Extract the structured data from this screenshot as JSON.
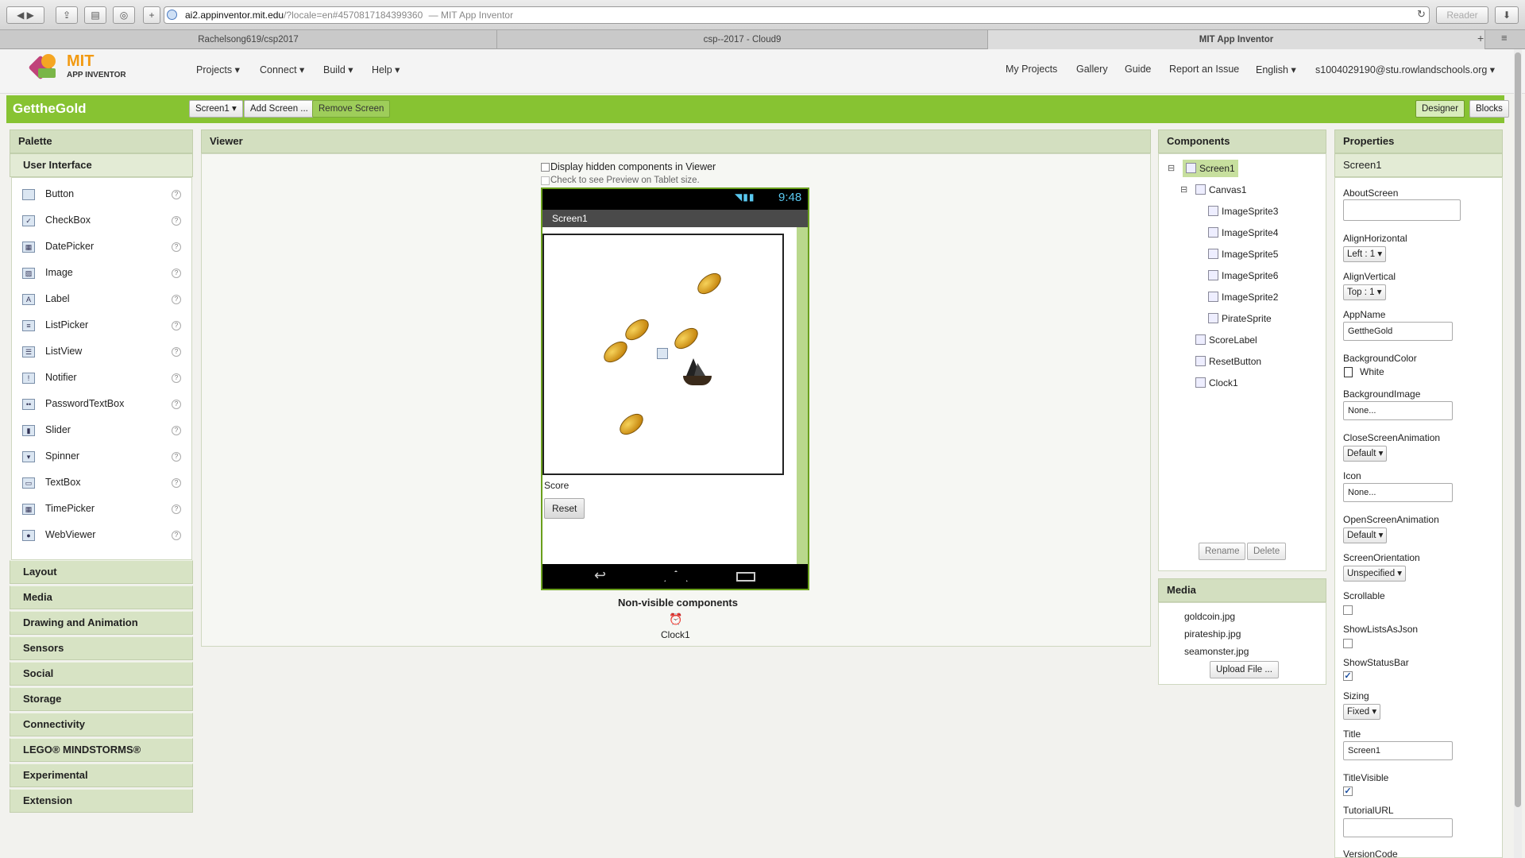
{
  "browser": {
    "url_host": "ai2.appinventor.mit.edu",
    "url_path": "/?locale=en#4570817184399360",
    "page_title": "— MIT App Inventor",
    "reader_label": "Reader",
    "tabs": [
      "Rachelsong619/csp2017",
      "csp--2017 - Cloud9",
      "MIT App Inventor"
    ]
  },
  "header": {
    "logo_mit": "MIT",
    "logo_sub": "APP INVENTOR",
    "menus": [
      "Projects ▾",
      "Connect ▾",
      "Build ▾",
      "Help ▾"
    ],
    "right_links": [
      "My Projects",
      "Gallery",
      "Guide",
      "Report an Issue",
      "English ▾",
      "s1004029190@stu.rowlandschools.org ▾"
    ]
  },
  "toolbar": {
    "project_name": "GettheGold",
    "screen_select": "Screen1 ▾",
    "add_screen": "Add Screen ...",
    "remove_screen": "Remove Screen",
    "designer": "Designer",
    "blocks": "Blocks"
  },
  "palette": {
    "title": "Palette",
    "open_category": "User Interface",
    "items": [
      {
        "label": "Button",
        "icon": "button-icon"
      },
      {
        "label": "CheckBox",
        "icon": "checkbox-icon"
      },
      {
        "label": "DatePicker",
        "icon": "datepicker-icon"
      },
      {
        "label": "Image",
        "icon": "image-icon"
      },
      {
        "label": "Label",
        "icon": "label-icon"
      },
      {
        "label": "ListPicker",
        "icon": "listpicker-icon"
      },
      {
        "label": "ListView",
        "icon": "listview-icon"
      },
      {
        "label": "Notifier",
        "icon": "notifier-icon"
      },
      {
        "label": "PasswordTextBox",
        "icon": "password-icon"
      },
      {
        "label": "Slider",
        "icon": "slider-icon"
      },
      {
        "label": "Spinner",
        "icon": "spinner-icon"
      },
      {
        "label": "TextBox",
        "icon": "textbox-icon"
      },
      {
        "label": "TimePicker",
        "icon": "timepicker-icon"
      },
      {
        "label": "WebViewer",
        "icon": "webviewer-icon"
      }
    ],
    "categories": [
      "Layout",
      "Media",
      "Drawing and Animation",
      "Sensors",
      "Social",
      "Storage",
      "Connectivity",
      "LEGO® MINDSTORMS®",
      "Experimental",
      "Extension"
    ]
  },
  "viewer": {
    "title": "Viewer",
    "hidden_checkbox_label": "Display hidden components in Viewer",
    "tablet_checkbox_label": "Check to see Preview on Tablet size.",
    "phone_time": "9:48",
    "screen_title": "Screen1",
    "score_label": "Score",
    "reset_button": "Reset",
    "nonvisible_title": "Non-visible components",
    "nonvisible_items": [
      "Clock1"
    ]
  },
  "components": {
    "title": "Components",
    "tree": [
      {
        "label": "Screen1",
        "level": 0,
        "toggle": "⊟",
        "selected": true
      },
      {
        "label": "Canvas1",
        "level": 1,
        "toggle": "⊟"
      },
      {
        "label": "ImageSprite3",
        "level": 2
      },
      {
        "label": "ImageSprite4",
        "level": 2
      },
      {
        "label": "ImageSprite5",
        "level": 2
      },
      {
        "label": "ImageSprite6",
        "level": 2
      },
      {
        "label": "ImageSprite2",
        "level": 2
      },
      {
        "label": "PirateSprite",
        "level": 2
      },
      {
        "label": "ScoreLabel",
        "level": 1
      },
      {
        "label": "ResetButton",
        "level": 1
      },
      {
        "label": "Clock1",
        "level": 1
      }
    ],
    "rename": "Rename",
    "delete": "Delete"
  },
  "media": {
    "title": "Media",
    "files": [
      "goldcoin.jpg",
      "pirateship.jpg",
      "seamonster.jpg"
    ],
    "upload": "Upload File ..."
  },
  "properties": {
    "title": "Properties",
    "component": "Screen1",
    "about_label": "AboutScreen",
    "about_value": "",
    "align_h_label": "AlignHorizontal",
    "align_h_value": "Left : 1 ▾",
    "align_v_label": "AlignVertical",
    "align_v_value": "Top : 1 ▾",
    "appname_label": "AppName",
    "appname_value": "GettheGold",
    "bgcolor_label": "BackgroundColor",
    "bgcolor_value": "White",
    "bgimage_label": "BackgroundImage",
    "bgimage_value": "None...",
    "close_anim_label": "CloseScreenAnimation",
    "close_anim_value": "Default ▾",
    "icon_label": "Icon",
    "icon_value": "None...",
    "open_anim_label": "OpenScreenAnimation",
    "open_anim_value": "Default ▾",
    "orientation_label": "ScreenOrientation",
    "orientation_value": "Unspecified ▾",
    "scrollable_label": "Scrollable",
    "scrollable": false,
    "showlists_label": "ShowListsAsJson",
    "showlists": false,
    "statusbar_label": "ShowStatusBar",
    "statusbar": true,
    "sizing_label": "Sizing",
    "sizing_value": "Fixed ▾",
    "title_label": "Title",
    "title_value": "Screen1",
    "titlevisible_label": "TitleVisible",
    "titlevisible": true,
    "tutorial_label": "TutorialURL",
    "tutorial_value": "",
    "versioncode_label": "VersionCode"
  },
  "colors": {
    "accent_green": "#87c332",
    "panel_header": "#d3dfc0"
  }
}
